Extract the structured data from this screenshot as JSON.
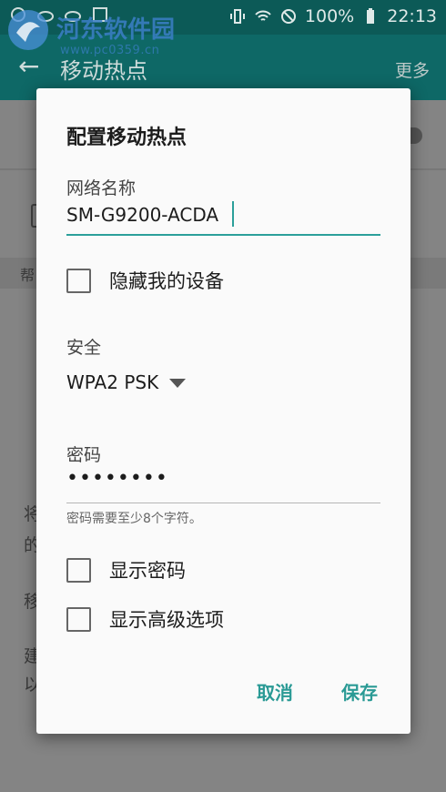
{
  "status_bar": {
    "battery": "100%",
    "time": "22:13"
  },
  "watermark": {
    "name": "河东软件园",
    "url": "www.pc0359.cn"
  },
  "action_bar": {
    "title": "移动热点",
    "more": "更多"
  },
  "background": {
    "band_text": "帮",
    "line1": "将",
    "line2": "的",
    "line3": "移",
    "line4": "建",
    "line5": "以"
  },
  "dialog": {
    "title": "配置移动热点",
    "network_name_label": "网络名称",
    "network_name_value": "SM-G9200-ACDA",
    "hide_device_label": "隐藏我的设备",
    "security_label": "安全",
    "security_value": "WPA2 PSK",
    "password_label": "密码",
    "password_masked": "••••••••",
    "password_helper": "密码需要至少8个字符。",
    "show_password_label": "显示密码",
    "show_advanced_label": "显示高级选项",
    "cancel_label": "取消",
    "save_label": "保存"
  },
  "colors": {
    "accent": "#2b9f9a",
    "action_bar": "#0e6866",
    "status_bar": "#0c5a57",
    "scrim_background": "#848484"
  }
}
